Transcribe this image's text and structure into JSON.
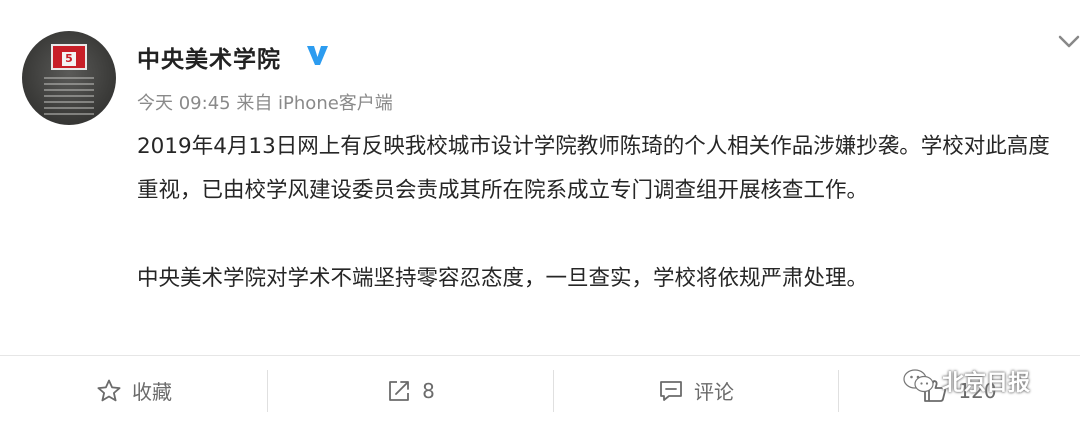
{
  "post": {
    "author": "中央美术学院",
    "meta": "今天 09:45 来自 iPhone客户端",
    "paragraphs": [
      "2019年4月13日网上有反映我校城市设计学院教师陈琦的个人相关作品涉嫌抄袭。学校对此高度重视，已由校学风建设委员会责成其所在院系成立专门调查组开展核查工作。",
      "中央美术学院对学术不端坚持零容忍态度，一旦查实，学校将依规严肃处理。"
    ]
  },
  "avatar": {
    "plate_number": "5"
  },
  "actions": {
    "favorite_label": "收藏",
    "repost_count": "8",
    "comment_label": "评论",
    "like_count": "120"
  },
  "watermark": {
    "text": "北京日报"
  },
  "colors": {
    "verified": "#2c9cf0",
    "text": "#262626",
    "meta": "#8a8a8a",
    "action": "#6b6b6b"
  },
  "icons": {
    "verified": "verified-v-icon",
    "menu": "chevron-down-icon",
    "favorite": "star-icon",
    "repost": "repost-icon",
    "comment": "comment-icon",
    "like": "thumbs-up-icon",
    "watermark": "wechat-icon"
  }
}
